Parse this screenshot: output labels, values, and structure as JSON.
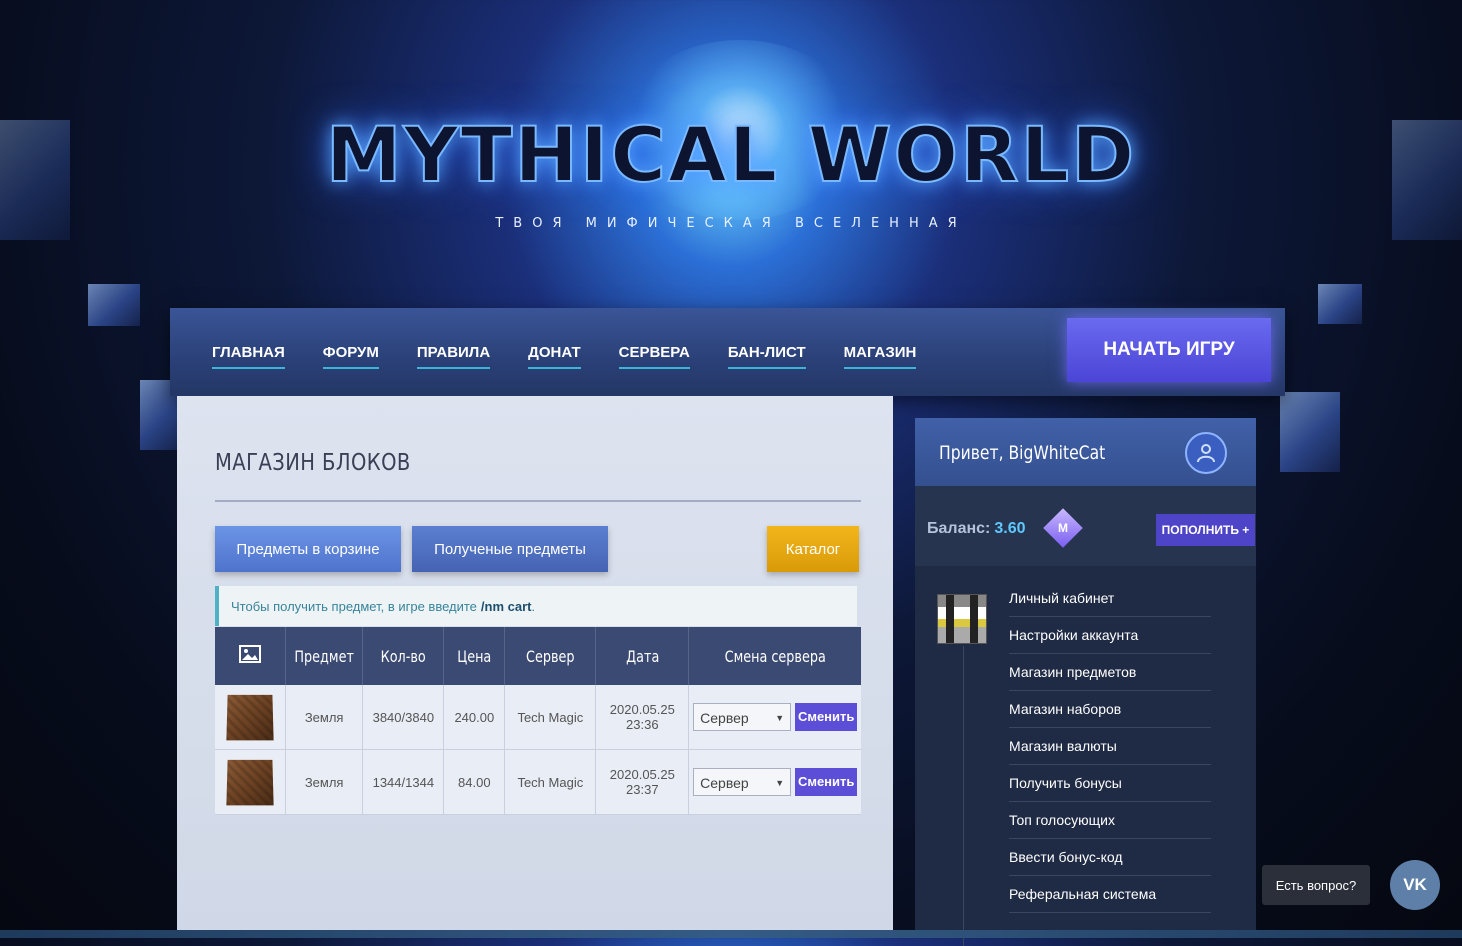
{
  "hero": {
    "title": "MYTHICAL WORLD",
    "subtitle": "ТВОЯ МИФИЧЕСКАЯ ВСЕЛЕННАЯ"
  },
  "nav": {
    "items": [
      {
        "label": "ГЛАВНАЯ"
      },
      {
        "label": "ФОРУМ"
      },
      {
        "label": "ПРАВИЛА"
      },
      {
        "label": "ДОНАТ"
      },
      {
        "label": "СЕРВЕРА"
      },
      {
        "label": "БАН-ЛИСТ"
      },
      {
        "label": "МАГАЗИН"
      }
    ],
    "start_label": "НАЧАТЬ ИГРУ"
  },
  "main": {
    "title": "МАГАЗИН БЛОКОВ",
    "buttons": {
      "cart": "Предметы в корзине",
      "received": "Полученые предметы",
      "catalog": "Каталог"
    },
    "info_text": "Чтобы получить предмет, в игре введите",
    "info_command": "/nm cart",
    "info_tail": ".",
    "table": {
      "headers": [
        "Предмет",
        "Кол-во",
        "Цена",
        "Сервер",
        "Дата",
        "Смена сервера"
      ],
      "rows": [
        {
          "item": "Земля",
          "qty": "3840/3840",
          "price": "240.00",
          "server": "Tech Magic",
          "date": "2020.05.25",
          "time": "23:36",
          "select": "Сервер",
          "action": "Сменить"
        },
        {
          "item": "Земля",
          "qty": "1344/1344",
          "price": "84.00",
          "server": "Tech Magic",
          "date": "2020.05.25",
          "time": "23:37",
          "select": "Сервер",
          "action": "Сменить"
        }
      ]
    }
  },
  "side": {
    "greeting": "Привет, BigWhiteCat",
    "balance_label": "Баланс:",
    "balance_value": "3.60",
    "coin_letter": "M",
    "topup_label": "ПОПОЛНИТЬ +",
    "menu": [
      "Личный кабинет",
      "Настройки аккаунта",
      "Магазин предметов",
      "Магазин наборов",
      "Магазин валюты",
      "Получить бонусы",
      "Топ голосующих",
      "Ввести бонус-код",
      "Реферальная система"
    ]
  },
  "widget": {
    "question": "Есть вопрос?",
    "vk": "VK"
  },
  "colors": {
    "accent": "#5c4ed6",
    "nav_underline": "#3db4d6",
    "catalog": "#f2b61c",
    "balance": "#5ec8ff"
  },
  "icons": [
    "image-icon",
    "user-icon",
    "coin-icon",
    "vk-icon",
    "chevron-down-icon"
  ]
}
